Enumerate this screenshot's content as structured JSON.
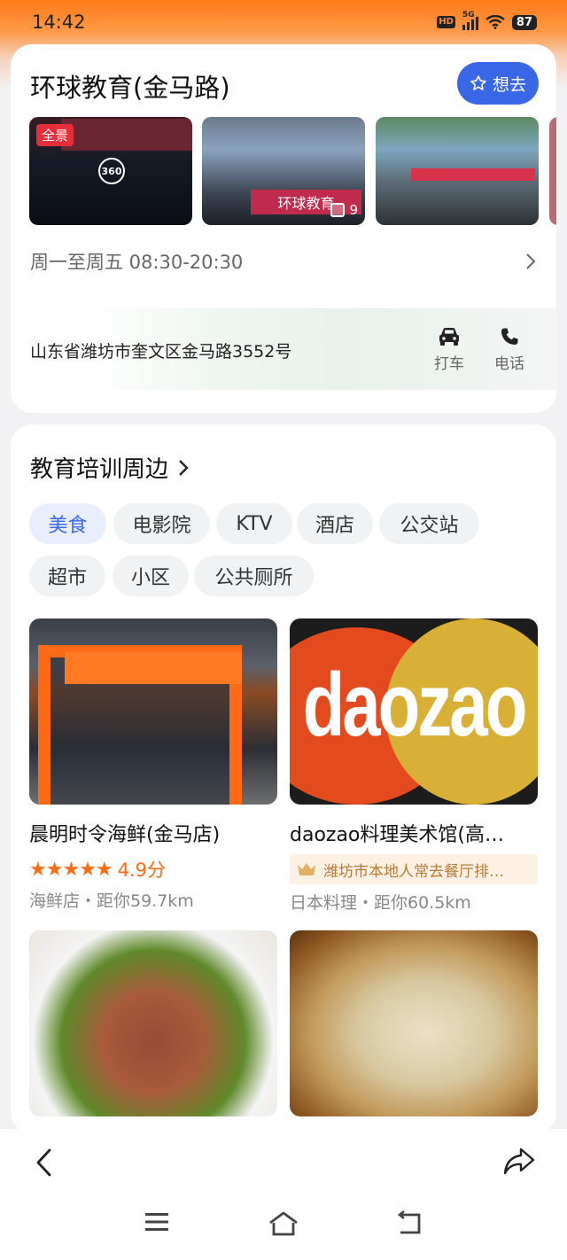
{
  "status_bar": {
    "time": "14:42",
    "hd": "HD",
    "network": "5G",
    "battery": "87"
  },
  "place": {
    "title": "环球教育(金马路)",
    "want_label": "想去",
    "photos": {
      "panorama_badge": "全景",
      "panorama_360": "360",
      "count": "9",
      "sign_text": "环球教育"
    },
    "hours": "周一至周五 08:30-20:30",
    "address": "山东省潍坊市奎文区金马路3552号",
    "actions": {
      "taxi": "打车",
      "phone": "电话"
    }
  },
  "nearby": {
    "title": "教育培训周边",
    "chips": [
      "美食",
      "电影院",
      "KTV",
      "酒店",
      "公交站",
      "超市",
      "小区",
      "公共厕所"
    ],
    "active_chip": "美食",
    "pois": [
      {
        "name": "晨明时令海鲜(金马店)",
        "stars": "★★★★★",
        "rating": "4.9分",
        "meta": "海鲜店・距你59.7km"
      },
      {
        "name": "daozao料理美术馆(高…",
        "logo_text": "daozao",
        "rank": "潍坊市本地人常去餐厅排…",
        "meta": "日本料理・距你60.5km"
      }
    ]
  },
  "colors": {
    "accent": "#3a66e8",
    "orange": "#ff6a14",
    "status_gradient": "#ff7a18"
  }
}
